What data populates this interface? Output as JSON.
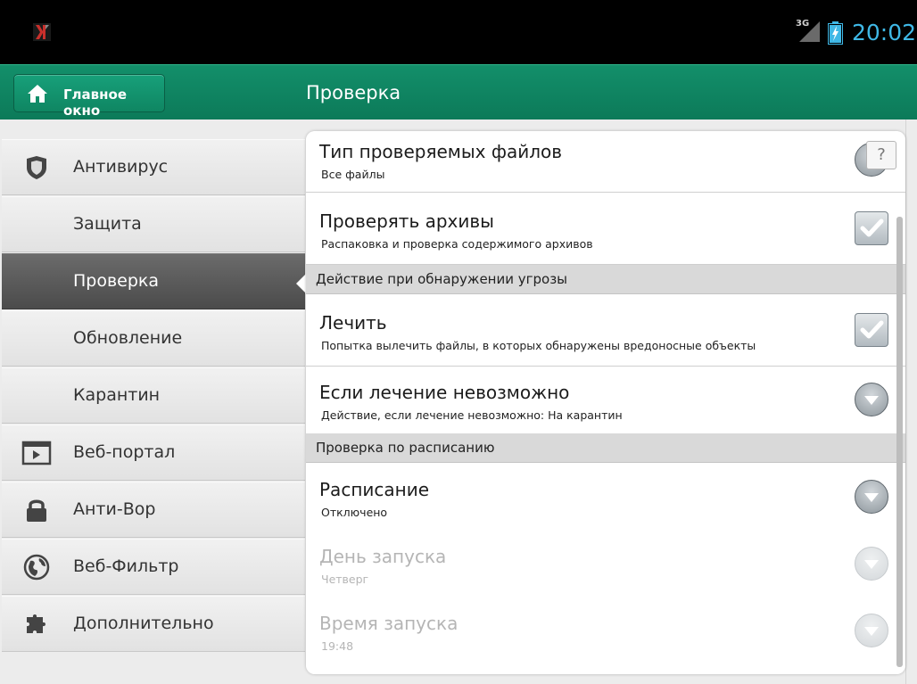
{
  "status_bar": {
    "network_label": "3G",
    "clock": "20:02",
    "clock_color": "#3fb8e6"
  },
  "header": {
    "home_button_label": "Главное окно",
    "title": "Проверка",
    "accent_color": "#0f8662"
  },
  "sidebar": {
    "items": [
      {
        "label": "Антивирус",
        "icon": "shield-icon",
        "active": false
      },
      {
        "label": "Защита",
        "icon": "",
        "active": false
      },
      {
        "label": "Проверка",
        "icon": "",
        "active": true
      },
      {
        "label": "Обновление",
        "icon": "",
        "active": false
      },
      {
        "label": "Карантин",
        "icon": "",
        "active": false
      },
      {
        "label": "Веб-портал",
        "icon": "web-portal-icon",
        "active": false
      },
      {
        "label": "Анти-Вор",
        "icon": "lock-icon",
        "active": false
      },
      {
        "label": "Веб-Фильтр",
        "icon": "globe-icon",
        "active": false
      },
      {
        "label": "Дополнительно",
        "icon": "puzzle-icon",
        "active": false
      }
    ]
  },
  "settings": {
    "file_types": {
      "title": "Тип проверяемых файлов",
      "subtitle": "Все файлы"
    },
    "check_archives": {
      "title": "Проверять архивы",
      "subtitle": "Распаковка и проверка содержимого архивов",
      "checked": true
    },
    "section_threat": "Действие при обнаружении угрозы",
    "cure": {
      "title": "Лечить",
      "subtitle": "Попытка вылечить файлы, в которых обнаружены вредоносные объекты",
      "checked": true
    },
    "cure_impossible": {
      "title": "Если лечение невозможно",
      "subtitle": "Действие, если лечение невозможно: На карантин"
    },
    "section_schedule": "Проверка по расписанию",
    "schedule": {
      "title": "Расписание",
      "subtitle": "Отключено"
    },
    "start_day": {
      "title": "День запуска",
      "subtitle": "Четверг",
      "enabled": false
    },
    "start_time": {
      "title": "Время запуска",
      "subtitle": "19:48",
      "enabled": false
    },
    "help_label": "?"
  }
}
